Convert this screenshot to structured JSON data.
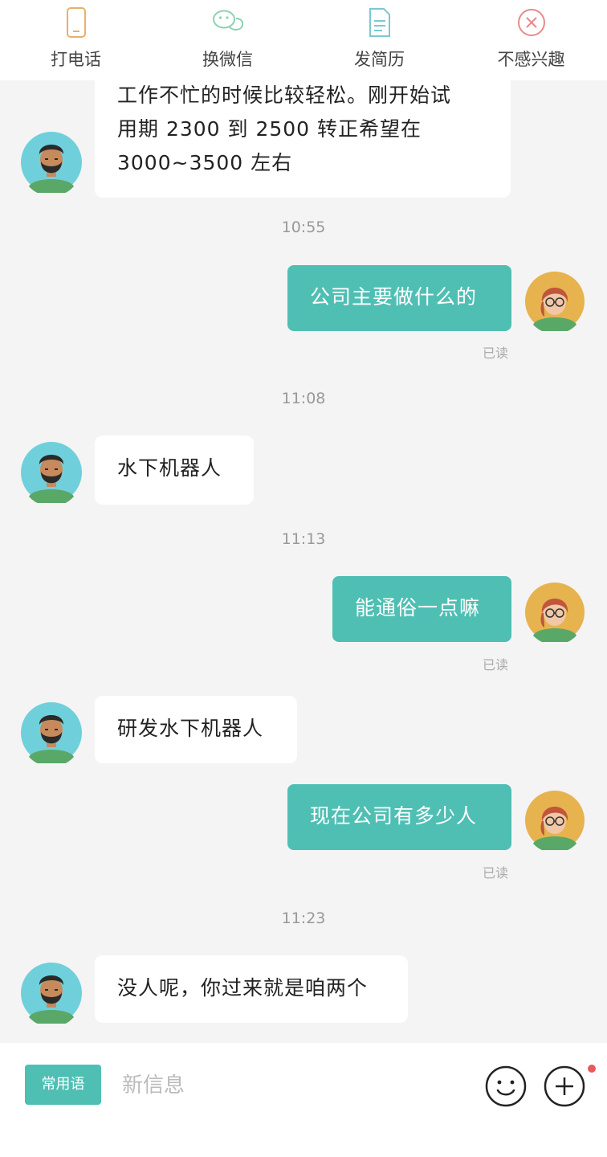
{
  "topbar": {
    "actions": [
      {
        "label": "打电话",
        "icon": "phone-icon",
        "color": "#e8b06a"
      },
      {
        "label": "换微信",
        "icon": "wechat-icon",
        "color": "#8ed2b0"
      },
      {
        "label": "发简历",
        "icon": "resume-icon",
        "color": "#7cc8cf"
      },
      {
        "label": "不感兴趣",
        "icon": "not-interested-icon",
        "color": "#e88a8a"
      }
    ]
  },
  "chat": {
    "messages": [
      {
        "from": "other",
        "lines": [
          "工作不忙的时候比较轻松。刚开始试",
          "用期 2300 到 2500 转正希望在",
          "3000~3500 左右"
        ]
      },
      {
        "time": "10:55"
      },
      {
        "from": "me",
        "text": "公司主要做什么的",
        "status": "已读"
      },
      {
        "time": "11:08"
      },
      {
        "from": "other",
        "text": "水下机器人"
      },
      {
        "time": "11:13"
      },
      {
        "from": "me",
        "text": "能通俗一点嘛",
        "status": "已读"
      },
      {
        "from": "other",
        "text": "研发水下机器人"
      },
      {
        "from": "me",
        "text": "现在公司有多少人",
        "status": "已读"
      },
      {
        "time": "11:23"
      },
      {
        "from": "other",
        "text": "没人呢，你过来就是咱两个"
      }
    ]
  },
  "bottombar": {
    "phrase_label": "常用语",
    "input_placeholder": "新信息",
    "emoji_icon": "emoji-icon",
    "plus_icon": "plus-icon",
    "has_notification_dot": true
  },
  "colors": {
    "accent": "#4fbfb4",
    "background": "#f4f4f4"
  }
}
